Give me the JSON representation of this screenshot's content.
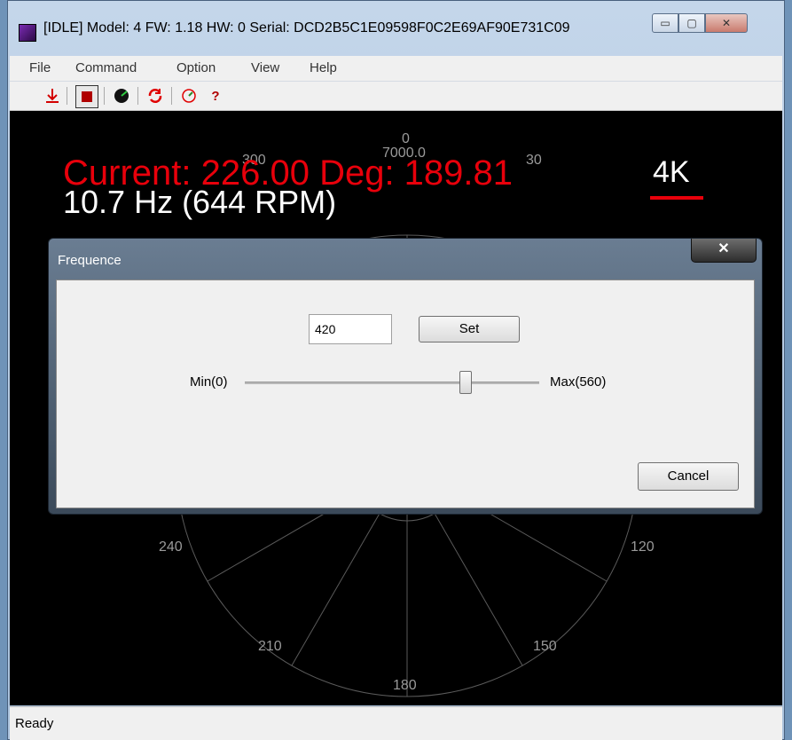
{
  "window": {
    "title": "[IDLE] Model: 4 FW: 1.18 HW: 0 Serial: DCD2B5C1E09598F0C2E69AF90E731C09",
    "min_label": "▭",
    "max_label": "▢",
    "close_label": "✕"
  },
  "menu": [
    "File",
    "Command",
    "Option",
    "View",
    "Help"
  ],
  "toolbar": {
    "icons": [
      "download-icon",
      "stop-icon",
      "radar-icon",
      "refresh-icon",
      "speed-icon",
      "help-icon"
    ],
    "help_label": "?"
  },
  "display": {
    "current_text": "Current: 226.00 Deg: 189.81",
    "hz_text": "10.7 Hz (644 RPM)",
    "quality": "4K",
    "range_label": "7000.0",
    "angle_labels": [
      "0",
      "30",
      "120",
      "150",
      "180",
      "210",
      "240",
      "300"
    ]
  },
  "dialog": {
    "title": "Frequence",
    "close_label": "✕",
    "input_value": "420",
    "set_label": "Set",
    "min_label": "Min(0)",
    "max_label": "Max(560)",
    "slider": {
      "min": 0,
      "max": 560,
      "value": 420
    },
    "cancel_label": "Cancel"
  },
  "status": "Ready",
  "colors": {
    "accent_red": "#e8000b",
    "canvas_bg": "#000000",
    "text_white": "#ffffff",
    "grid": "#5a5a5a"
  }
}
